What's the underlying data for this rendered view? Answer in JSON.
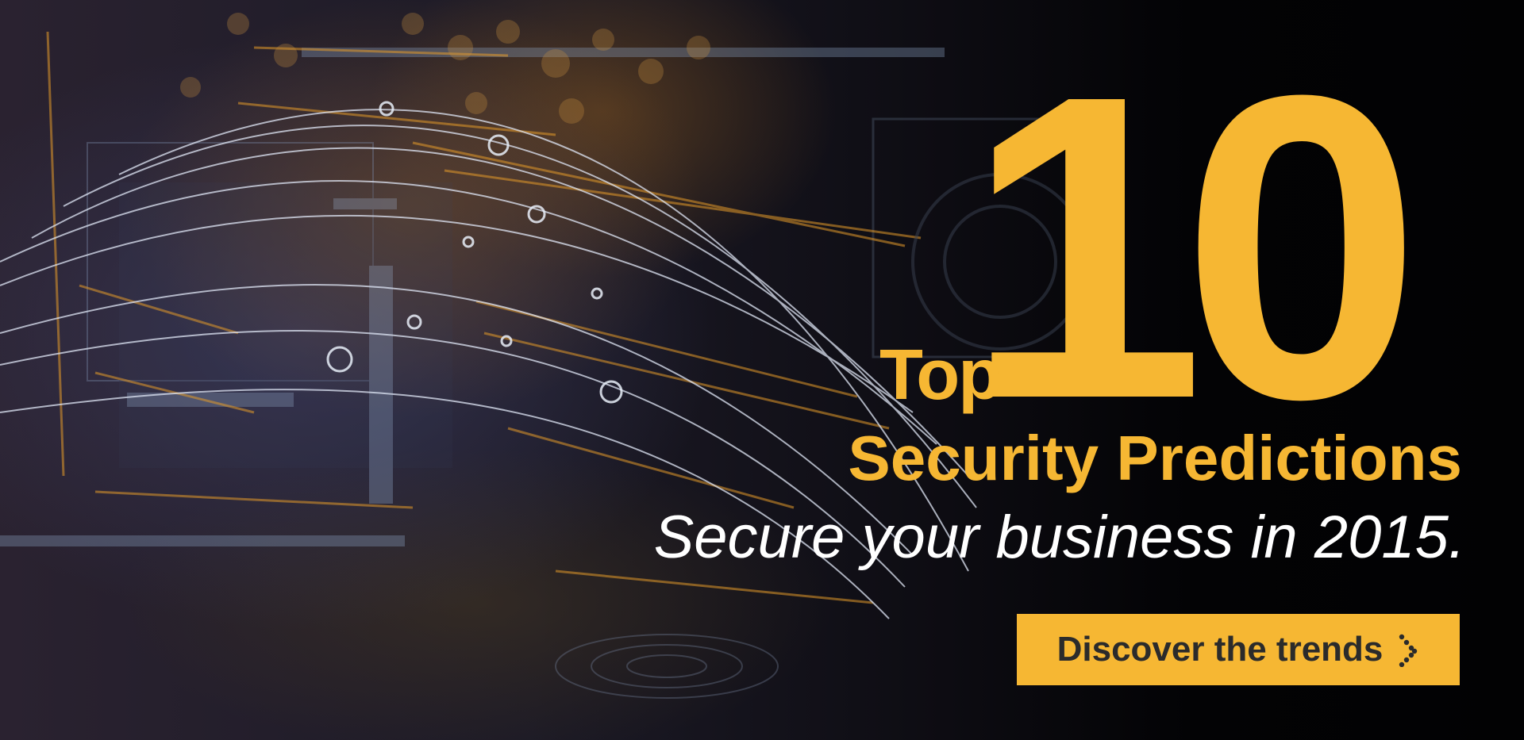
{
  "banner": {
    "number": "10",
    "top_label": "Top",
    "headline": "Security Predictions",
    "subline": "Secure your business in 2015.",
    "cta": {
      "label": "Discover the trends",
      "icon": "chevron-right-icon"
    }
  },
  "colors": {
    "accent": "#f6b733",
    "background": "#050507",
    "subline_text": "#ffffff",
    "cta_text": "#2b2b2b"
  }
}
